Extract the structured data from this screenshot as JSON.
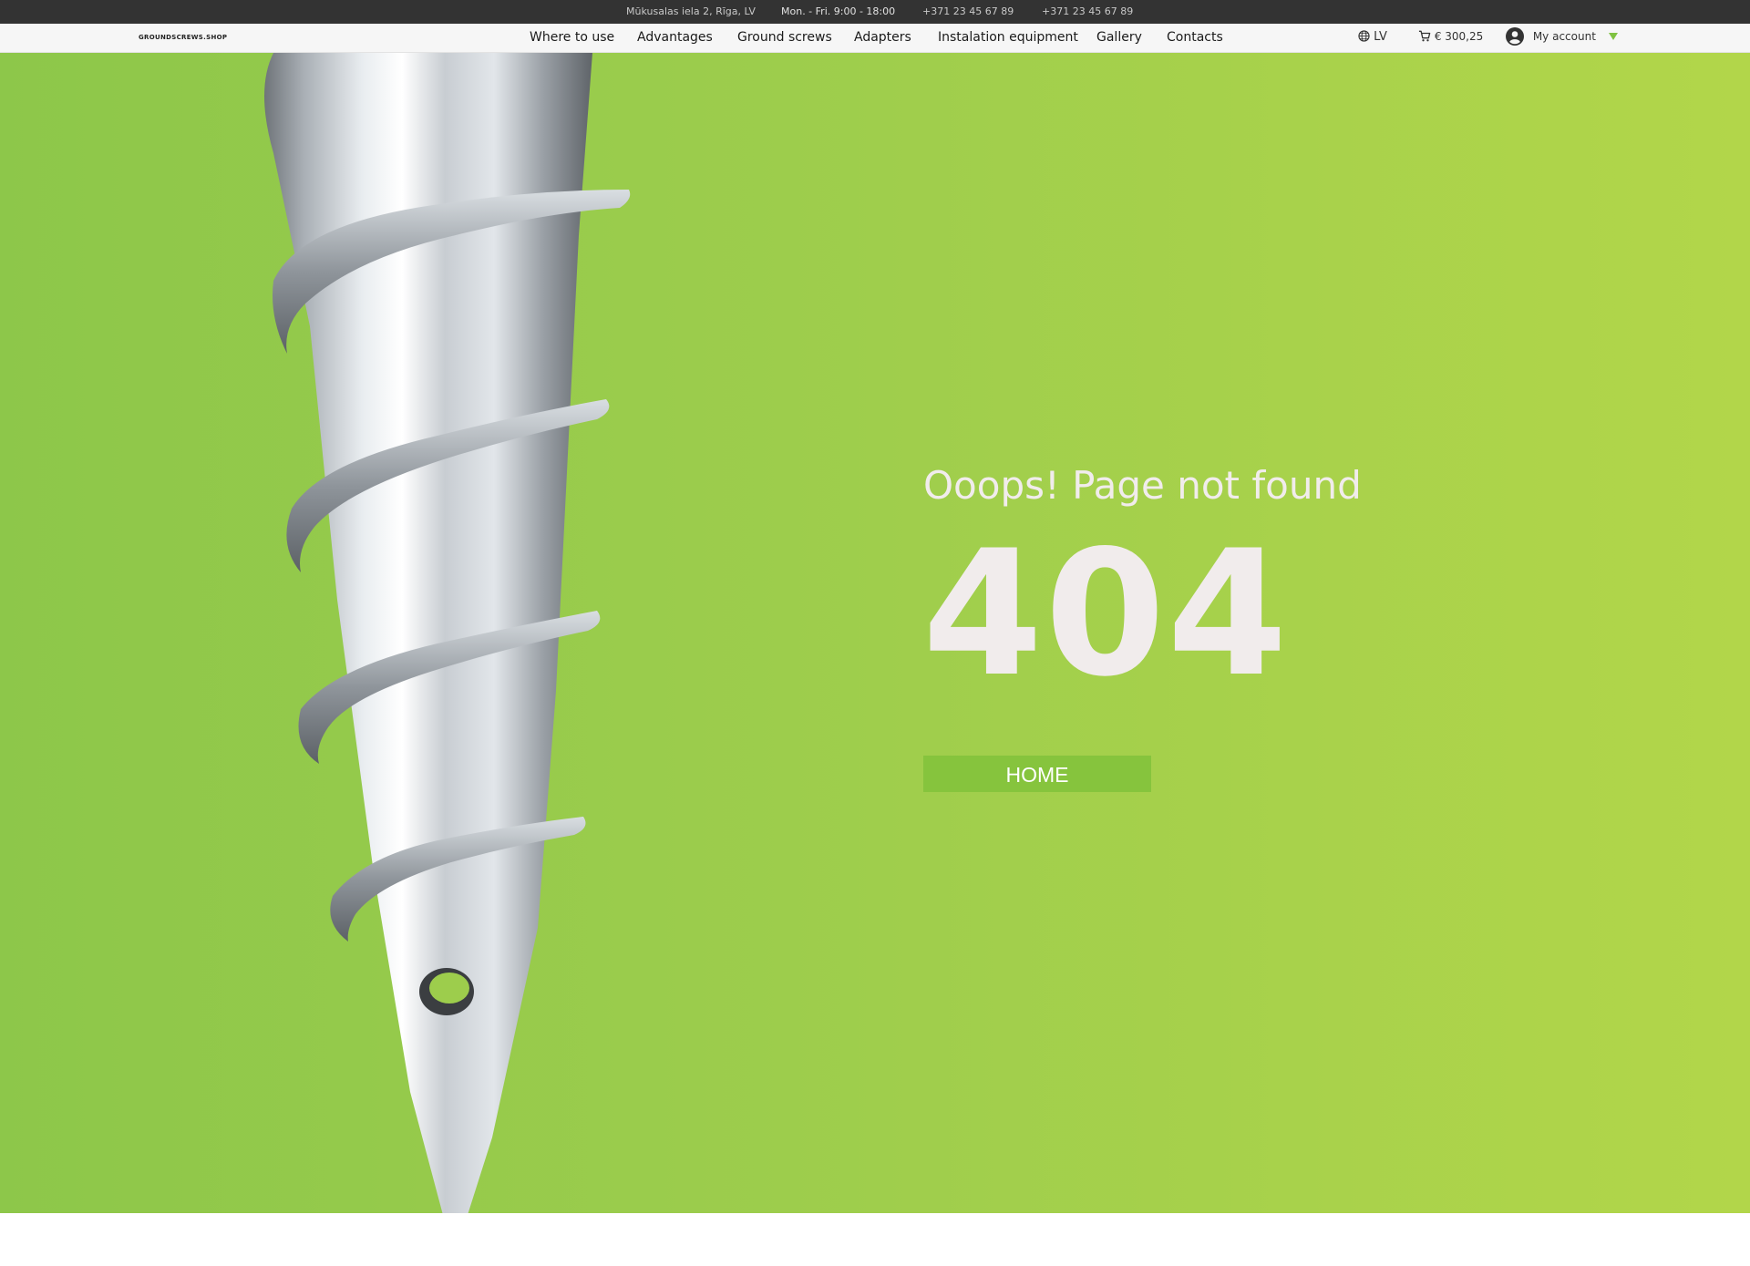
{
  "topbar": {
    "address": "Mūkusalas iela 2, Rīga, LV",
    "hours": "Mon. - Fri. 9:00 - 18:00",
    "phone1": "+371 23 45 67 89",
    "phone2": "+371 23 45 67 89"
  },
  "header": {
    "logo": "GROUNDSCREWS.SHOP",
    "nav": [
      {
        "label": "Where to use"
      },
      {
        "label": "Advantages"
      },
      {
        "label": "Ground screws"
      },
      {
        "label": "Adapters"
      },
      {
        "label": "Instalation equipment"
      },
      {
        "label": "Gallery"
      },
      {
        "label": "Contacts"
      }
    ],
    "language": "LV",
    "cart_total": "€ 300,25",
    "account_label": "My account"
  },
  "main": {
    "headline": "Ooops! Page not found",
    "error_code": "404",
    "home_button": "HOME"
  },
  "icons": {
    "language": "globe-icon",
    "cart": "cart-icon",
    "account": "user-circle-icon",
    "dropdown": "chevron-down-icon"
  },
  "colors": {
    "topbar_bg": "#333333",
    "hero_green": "#9dcd4c",
    "button_green": "#86c43d",
    "text_light": "#f1ecec",
    "accent": "#7fc241"
  }
}
